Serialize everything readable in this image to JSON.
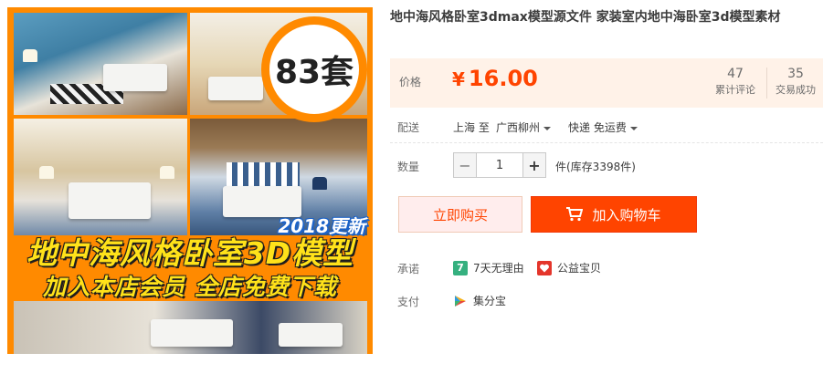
{
  "gallery": {
    "badge_count": "83套",
    "year_tag": "2018更新",
    "headline": "地中海风格卧室3D模型",
    "subline": "加入本店会员 全店免费下载"
  },
  "product": {
    "title": "地中海风格卧室3dmax模型源文件 家装室内地中海卧室3d模型素材"
  },
  "price": {
    "label": "价格",
    "currency": "¥",
    "value": "16.00",
    "reviews_count": "47",
    "reviews_label": "累计评论",
    "sales_count": "35",
    "sales_label": "交易成功"
  },
  "shipping": {
    "label": "配送",
    "from": "上海 至",
    "to": "广西柳州",
    "method": "快递 免运费"
  },
  "quantity": {
    "label": "数量",
    "minus": "−",
    "value": "1",
    "plus": "+",
    "stock": "件(库存3398件)"
  },
  "actions": {
    "buy_now": "立即购买",
    "add_to_cart": "加入购物车"
  },
  "promise": {
    "label": "承诺",
    "items": [
      {
        "icon": "7",
        "text": "7天无理由"
      },
      {
        "icon": "charity-icon",
        "text": "公益宝贝"
      }
    ]
  },
  "payment": {
    "label": "支付",
    "items": [
      {
        "icon": "jifenbao-icon",
        "text": "集分宝"
      }
    ]
  },
  "colors": {
    "accent": "#ff4400",
    "price_bg": "#fff2e8",
    "banner_orange": "#ff8a00",
    "banner_text": "#ffe21a"
  }
}
